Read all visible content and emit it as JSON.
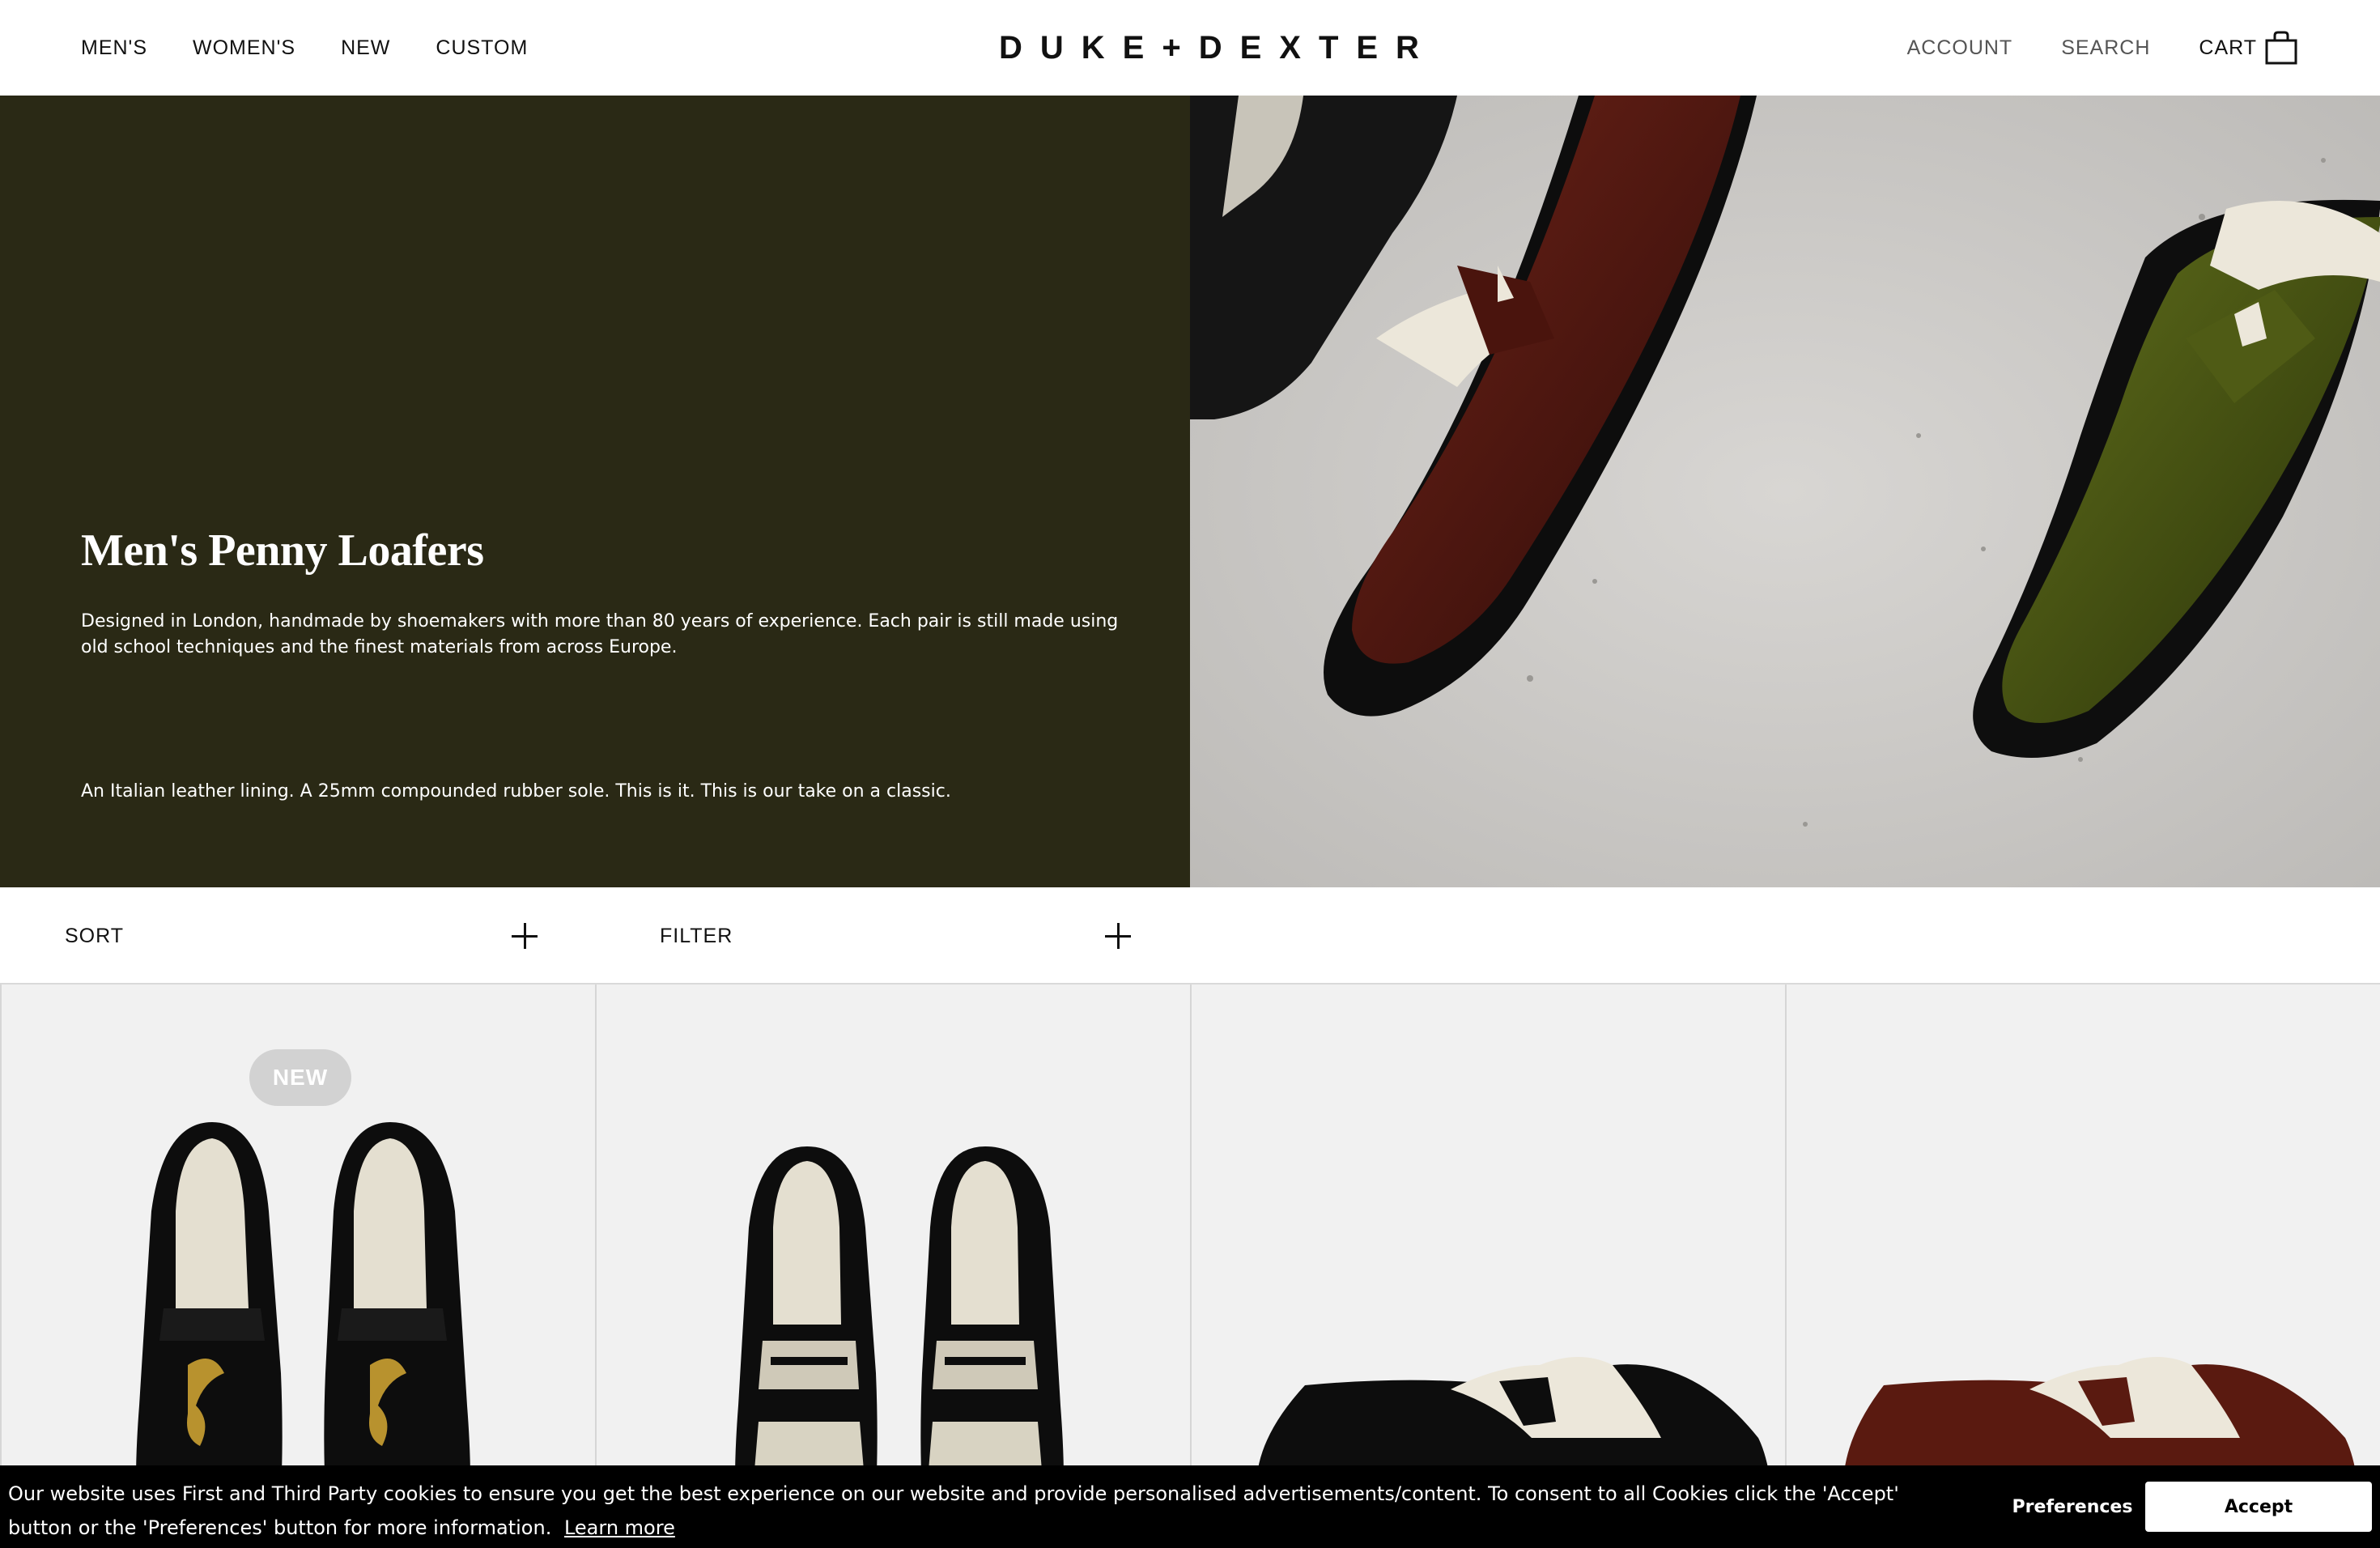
{
  "brand": {
    "logo": "DUKE+DEXTER"
  },
  "nav": {
    "left": [
      "MEN'S",
      "WOMEN'S",
      "NEW",
      "CUSTOM"
    ],
    "account": "ACCOUNT",
    "search": "SEARCH",
    "cart": "CART"
  },
  "hero": {
    "title": "Men's Penny Loafers",
    "description": "Designed in London, handmade by shoemakers with more than 80 years of experience. Each pair is still made using old school techniques and the finest materials from across Europe.",
    "description2": "An Italian leather lining. A 25mm compounded rubber sole. This is it. This is our take on a classic."
  },
  "controls": {
    "sort": "SORT",
    "filter": "FILTER"
  },
  "products": [
    {
      "badge": "NEW"
    },
    {
      "badge": ""
    },
    {
      "badge": ""
    },
    {
      "badge": ""
    }
  ],
  "cookie": {
    "text": "Our website uses First and Third Party cookies to ensure you get the best experience on our website and provide personalised advertisements/content. To consent to all Cookies click the 'Accept' button or the 'Preferences' button for more information.",
    "learn_more": "Learn more",
    "preferences": "Preferences",
    "accept": "Accept"
  }
}
